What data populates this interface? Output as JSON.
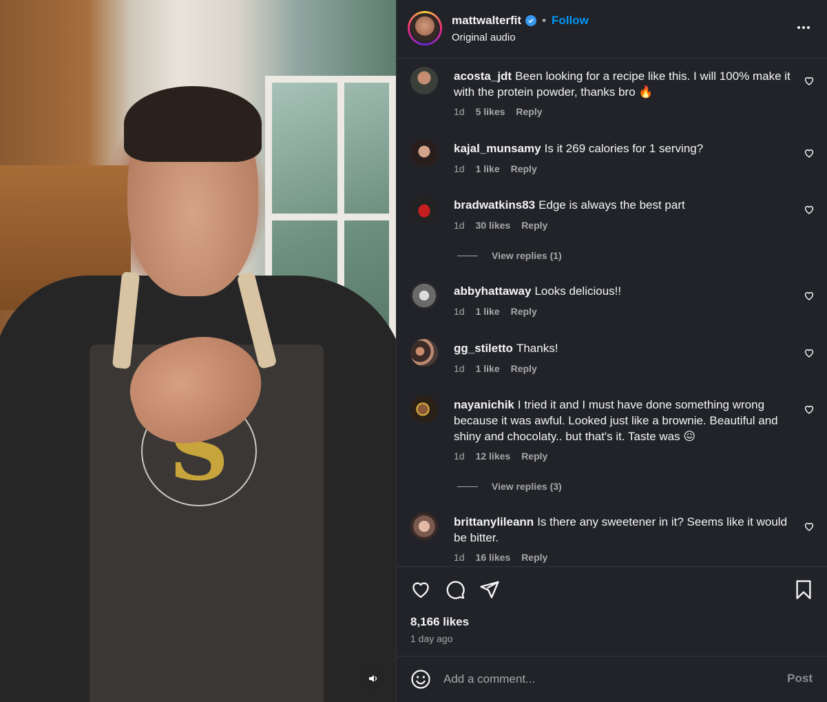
{
  "header": {
    "username": "mattwalterfit",
    "separator": "•",
    "follow_label": "Follow",
    "audio": "Original audio",
    "more_icon": "more-options-icon"
  },
  "comments": [
    {
      "username": "acosta_jdt",
      "text": "Been looking for a recipe like this. I will 100% make it with the protein powder, thanks bro 🔥",
      "time": "1d",
      "likes": "5 likes",
      "reply": "Reply",
      "avatar_color": "#4a5048"
    },
    {
      "username": "kajal_munsamy",
      "text": "Is it 269 calories for 1 serving?",
      "time": "1d",
      "likes": "1 like",
      "reply": "Reply",
      "avatar_color": "#3a2c2a"
    },
    {
      "username": "bradwatkins83",
      "text": "Edge is always the best part",
      "time": "1d",
      "likes": "30 likes",
      "reply": "Reply",
      "avatar_color": "#8a1b1b",
      "view_replies": "View replies (1)"
    },
    {
      "username": "abbyhattaway",
      "text": "Looks delicious!!",
      "time": "1d",
      "likes": "1 like",
      "reply": "Reply",
      "avatar_color": "#9a9a9a"
    },
    {
      "username": "gg_stiletto",
      "text": "Thanks!",
      "time": "1d",
      "likes": "1 like",
      "reply": "Reply",
      "avatar_color": "#5a4a46"
    },
    {
      "username": "nayanichik",
      "text": "I tried it and I must have done something wrong because it was awful. Looked just like a brownie. Beautiful and shiny and chocolaty.. but that's it. Taste was 😖",
      "time": "1d",
      "likes": "12 likes",
      "reply": "Reply",
      "avatar_color": "#6b4a2a",
      "view_replies": "View replies (3)"
    },
    {
      "username": "brittanylileann",
      "text": "Is there any sweetener in it? Seems like it would be bitter.",
      "time": "1d",
      "likes": "16 likes",
      "reply": "Reply",
      "avatar_color": "#b08a7a"
    }
  ],
  "actions": {
    "like_icon": "heart-icon",
    "comment_icon": "comment-icon",
    "share_icon": "share-icon",
    "save_icon": "bookmark-icon",
    "likes_count": "8,166 likes",
    "posted": "1 day ago"
  },
  "comment_box": {
    "placeholder": "Add a comment...",
    "post_label": "Post"
  },
  "colors": {
    "panel_bg": "#212328",
    "follow_blue": "#0095f6",
    "muted_text": "#a8a8a8"
  }
}
